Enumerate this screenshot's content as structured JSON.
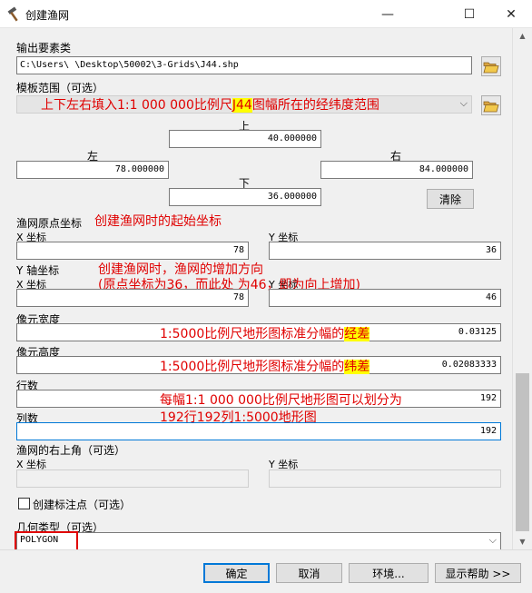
{
  "window": {
    "title": "创建渔网",
    "minimize": "—",
    "maximize": "☐",
    "close": "✕"
  },
  "output": {
    "label": "输出要素类",
    "value": "C:\\Users\\      \\Desktop\\50002\\3-Grids\\J44.shp"
  },
  "template": {
    "label": "模板范围（可选）",
    "combo_arrow": "⌵",
    "top_label": "上",
    "top_value": "40.000000",
    "left_label": "左",
    "left_value": "78.000000",
    "right_label": "右",
    "right_value": "84.000000",
    "bottom_label": "下",
    "bottom_value": "36.000000",
    "clear_button": "清除"
  },
  "origin": {
    "label": "渔网原点坐标",
    "x_label": "X 坐标",
    "x_value": "78",
    "y_label": "Y 坐标",
    "y_value": "36"
  },
  "yaxis": {
    "label": "Y 轴坐标",
    "x_label": "X 坐标",
    "x_value": "78",
    "y_label": "Y 坐标",
    "y_value": "46"
  },
  "cell_width": {
    "label": "像元宽度",
    "value": "0.03125"
  },
  "cell_height": {
    "label": "像元高度",
    "value": "0.02083333"
  },
  "rows": {
    "label": "行数",
    "value": "192"
  },
  "columns": {
    "label": "列数",
    "value": "192"
  },
  "opposite_corner": {
    "label": "渔网的右上角（可选）",
    "x_label": "X 坐标",
    "x_value": "",
    "y_label": "Y 坐标",
    "y_value": ""
  },
  "label_points": {
    "label": "创建标注点（可选）",
    "checked": false
  },
  "geometry": {
    "label": "几何类型（可选）",
    "value": "POLYGON",
    "arrow": "⌵"
  },
  "buttons": {
    "ok": "确定",
    "cancel": "取消",
    "env": "环境...",
    "help": "显示帮助 >>"
  },
  "annotations": {
    "template_pre": "上下左右填入1:1 000 000比例尺",
    "template_hl": "J44",
    "template_post": "图幅所在的经纬度范围",
    "origin": "创建渔网时的起始坐标",
    "yaxis_line1": "创建渔网时，渔网的增加方向",
    "yaxis_line2": "(原点坐标为36，而此处      为46，即为向上增加)",
    "cell_width_pre": "1:5000比例尺地形图标准分幅的",
    "cell_width_hl": "经差",
    "cell_height_pre": "1:5000比例尺地形图标准分幅的",
    "cell_height_hl": "纬差",
    "rows_line1": "每幅1:1 000 000比例尺地形图可以划分为",
    "rows_line2": "192行192列1:5000地形图"
  },
  "colors": {
    "annotation": "#e00000",
    "highlight": "#ffff00",
    "focus_border": "#0078d7"
  }
}
